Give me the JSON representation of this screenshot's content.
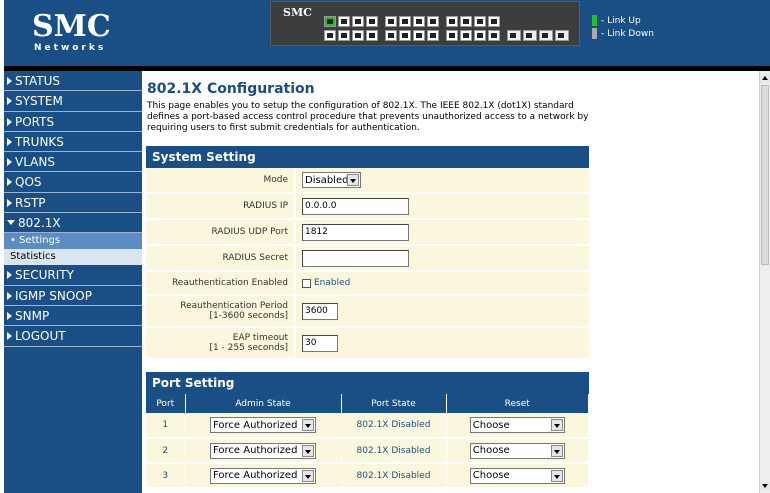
{
  "brand": {
    "logo": "SMC",
    "sub": "Networks",
    "device_brand": "SMC"
  },
  "legend": {
    "link_up": "- Link Up",
    "link_down": "- Link Down",
    "link_up_color": "#22c02a",
    "link_down_color": "#aaaaaa"
  },
  "nav": {
    "status": "STATUS",
    "system": "SYSTEM",
    "ports": "PORTS",
    "trunks": "TRUNKS",
    "vlans": "VLANS",
    "qos": "QOS",
    "rstp": "RSTP",
    "dot1x": "802.1X",
    "settings": "• Settings",
    "statistics": "Statistics",
    "security": "SECURITY",
    "igmp": "IGMP SNOOP",
    "snmp": "SNMP",
    "logout": "LOGOUT"
  },
  "page": {
    "title": "802.1X Configuration",
    "description": "This page enables you to setup the configuration of 802.1X. The IEEE 802.1X (dot1X) standard defines a port-based access control procedure that prevents unauthorized access to a network by requiring users to first submit credentials for authentication."
  },
  "system": {
    "header": "System Setting",
    "mode_label": "Mode",
    "mode_value": "Disabled",
    "radius_ip_label": "RADIUS IP",
    "radius_ip_value": "0.0.0.0",
    "radius_port_label": "RADIUS UDP Port",
    "radius_port_value": "1812",
    "radius_secret_label": "RADIUS Secret",
    "radius_secret_value": "",
    "reauth_label": "Reauthentication Enabled",
    "reauth_check_label": "Enabled",
    "reauth_period_label": "Reauthentication Period",
    "reauth_period_range": "[1-3600 seconds]",
    "reauth_period_value": "3600",
    "eap_label": "EAP timeout",
    "eap_range": "[1 - 255 seconds]",
    "eap_value": "30"
  },
  "ports": {
    "header": "Port Setting",
    "col_port": "Port",
    "col_admin": "Admin State",
    "col_state": "Port State",
    "col_reset": "Reset",
    "rows": [
      {
        "port": "1",
        "admin": "Force Authorized",
        "state": "802.1X Disabled",
        "reset": "Choose"
      },
      {
        "port": "2",
        "admin": "Force Authorized",
        "state": "802.1X Disabled",
        "reset": "Choose"
      },
      {
        "port": "3",
        "admin": "Force Authorized",
        "state": "802.1X Disabled",
        "reset": "Choose"
      }
    ]
  }
}
